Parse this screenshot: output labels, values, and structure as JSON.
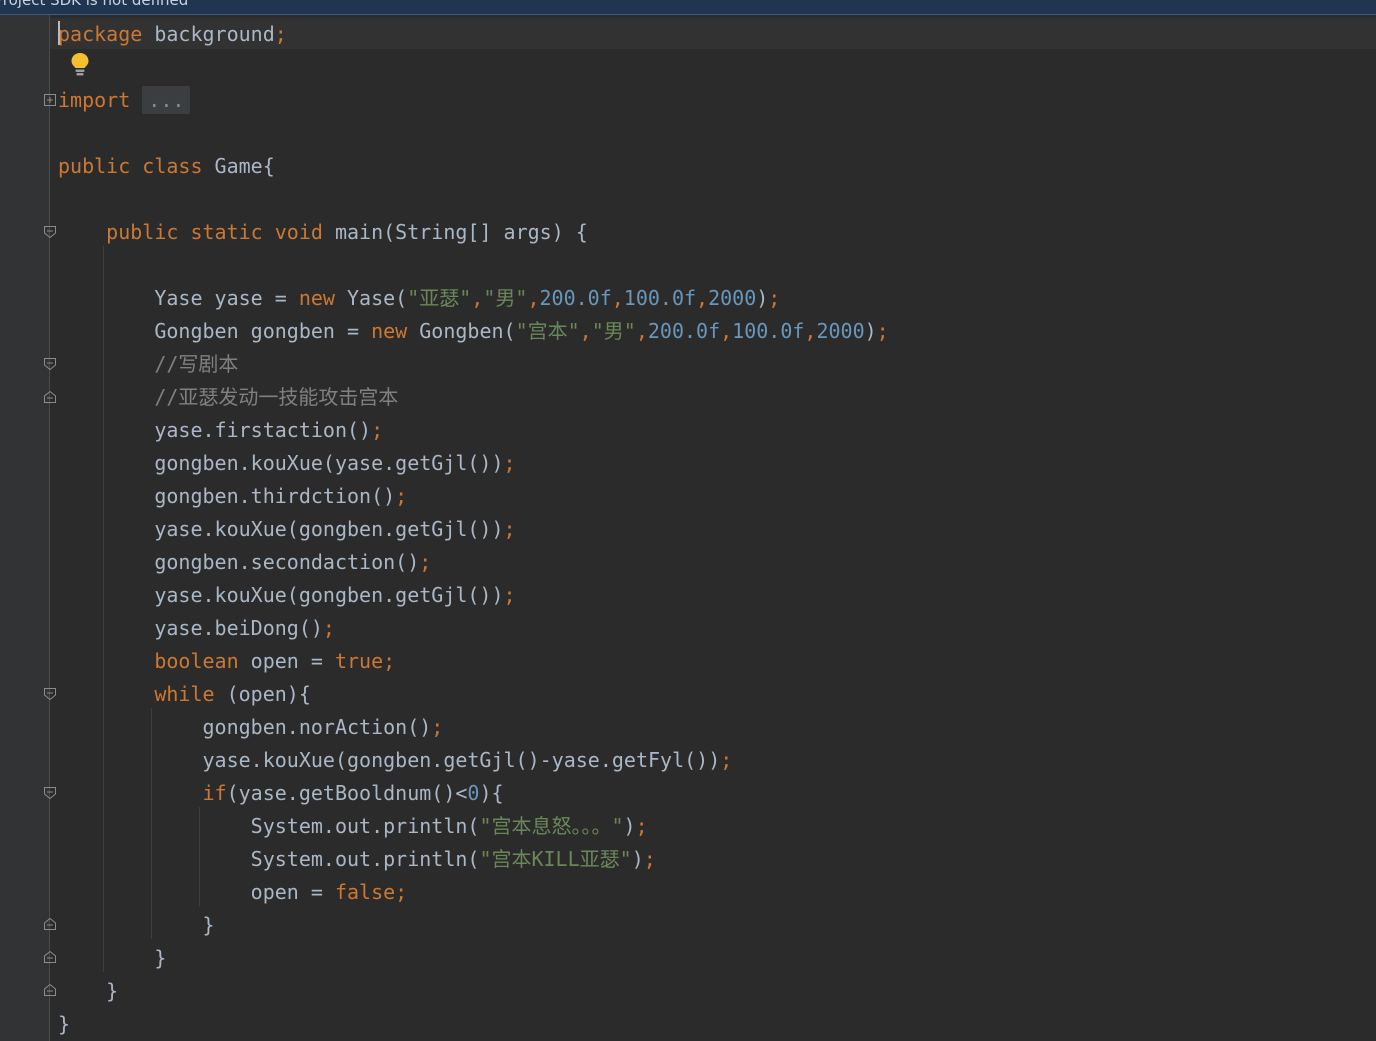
{
  "banner": {
    "text": "Project SDK is not defined"
  },
  "editor": {
    "lines": [
      [
        {
          "t": "package",
          "c": "kw"
        },
        {
          "t": " background"
        },
        {
          "t": ";",
          "c": "semi"
        }
      ],
      [],
      [
        {
          "t": "import",
          "c": "kw"
        },
        {
          "t": " "
        },
        {
          "t": "...",
          "c": "folded"
        }
      ],
      [],
      [
        {
          "t": "public class",
          "c": "kw"
        },
        {
          "t": " Game{"
        }
      ],
      [],
      [
        {
          "t": "    "
        },
        {
          "t": "public static void",
          "c": "kw"
        },
        {
          "t": " main(String[] args) {"
        }
      ],
      [],
      [
        {
          "t": "        Yase yase = "
        },
        {
          "t": "new",
          "c": "kw"
        },
        {
          "t": " Yase("
        },
        {
          "t": "\"亚瑟\"",
          "c": "str"
        },
        {
          "t": ",",
          "c": "semi"
        },
        {
          "t": "\"男\"",
          "c": "str"
        },
        {
          "t": ",",
          "c": "semi"
        },
        {
          "t": "200.0f",
          "c": "num"
        },
        {
          "t": ",",
          "c": "semi"
        },
        {
          "t": "100.0f",
          "c": "num"
        },
        {
          "t": ",",
          "c": "semi"
        },
        {
          "t": "2000",
          "c": "num"
        },
        {
          "t": ")"
        },
        {
          "t": ";",
          "c": "semi"
        }
      ],
      [
        {
          "t": "        Gongben gongben = "
        },
        {
          "t": "new",
          "c": "kw"
        },
        {
          "t": " Gongben("
        },
        {
          "t": "\"宫本\"",
          "c": "str"
        },
        {
          "t": ",",
          "c": "semi"
        },
        {
          "t": "\"男\"",
          "c": "str"
        },
        {
          "t": ",",
          "c": "semi"
        },
        {
          "t": "200.0f",
          "c": "num"
        },
        {
          "t": ",",
          "c": "semi"
        },
        {
          "t": "100.0f",
          "c": "num"
        },
        {
          "t": ",",
          "c": "semi"
        },
        {
          "t": "2000",
          "c": "num"
        },
        {
          "t": ")"
        },
        {
          "t": ";",
          "c": "semi"
        }
      ],
      [
        {
          "t": "        //写剧本",
          "c": "cmt"
        }
      ],
      [
        {
          "t": "        //亚瑟发动一技能攻击宫本",
          "c": "cmt"
        }
      ],
      [
        {
          "t": "        yase.firstaction()"
        },
        {
          "t": ";",
          "c": "semi"
        }
      ],
      [
        {
          "t": "        gongben.kouXue(yase.getGjl())"
        },
        {
          "t": ";",
          "c": "semi"
        }
      ],
      [
        {
          "t": "        gongben.thirdction()"
        },
        {
          "t": ";",
          "c": "semi"
        }
      ],
      [
        {
          "t": "        yase.kouXue(gongben.getGjl())"
        },
        {
          "t": ";",
          "c": "semi"
        }
      ],
      [
        {
          "t": "        gongben.secondaction()"
        },
        {
          "t": ";",
          "c": "semi"
        }
      ],
      [
        {
          "t": "        yase.kouXue(gongben.getGjl())"
        },
        {
          "t": ";",
          "c": "semi"
        }
      ],
      [
        {
          "t": "        yase.beiDong()"
        },
        {
          "t": ";",
          "c": "semi"
        }
      ],
      [
        {
          "t": "        "
        },
        {
          "t": "boolean",
          "c": "kw"
        },
        {
          "t": " open = "
        },
        {
          "t": "true",
          "c": "kw"
        },
        {
          "t": ";",
          "c": "semi"
        }
      ],
      [
        {
          "t": "        "
        },
        {
          "t": "while",
          "c": "kw"
        },
        {
          "t": " (open){"
        }
      ],
      [
        {
          "t": "            gongben.norAction()"
        },
        {
          "t": ";",
          "c": "semi"
        }
      ],
      [
        {
          "t": "            yase.kouXue(gongben.getGjl()-yase.getFyl())"
        },
        {
          "t": ";",
          "c": "semi"
        }
      ],
      [
        {
          "t": "            "
        },
        {
          "t": "if",
          "c": "kw"
        },
        {
          "t": "(yase.getBooldnum()<"
        },
        {
          "t": "0",
          "c": "num"
        },
        {
          "t": "){"
        }
      ],
      [
        {
          "t": "                System.out.println("
        },
        {
          "t": "\"宫本息怒。。。\"",
          "c": "str"
        },
        {
          "t": ")"
        },
        {
          "t": ";",
          "c": "semi"
        }
      ],
      [
        {
          "t": "                System.out.println("
        },
        {
          "t": "\"宫本KILL亚瑟\"",
          "c": "str"
        },
        {
          "t": ")"
        },
        {
          "t": ";",
          "c": "semi"
        }
      ],
      [
        {
          "t": "                open = "
        },
        {
          "t": "false",
          "c": "kw"
        },
        {
          "t": ";",
          "c": "semi"
        }
      ],
      [
        {
          "t": "            }"
        }
      ],
      [
        {
          "t": "        }"
        }
      ],
      [
        {
          "t": "    }"
        }
      ],
      [
        {
          "t": "}"
        }
      ]
    ]
  }
}
